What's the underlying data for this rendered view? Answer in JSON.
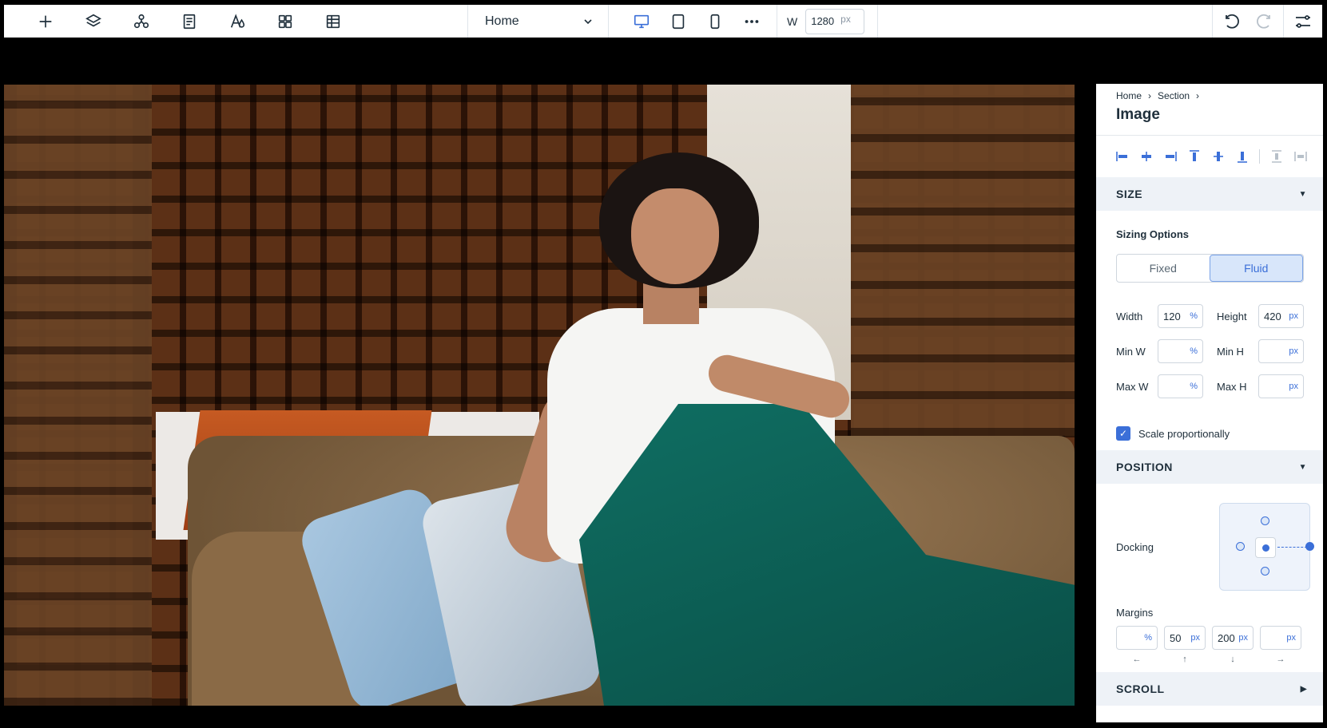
{
  "toolbar": {
    "page_select": "Home",
    "width_label": "W",
    "width_value": "1280",
    "width_unit": "px"
  },
  "panel": {
    "breadcrumb": [
      "Home",
      "Section"
    ],
    "title": "Image",
    "size_section": "SIZE",
    "sizing_options_label": "Sizing Options",
    "sizing_fixed": "Fixed",
    "sizing_fluid": "Fluid",
    "width_label": "Width",
    "width_value": "120",
    "width_unit": "%",
    "height_label": "Height",
    "height_value": "420",
    "height_unit": "px",
    "minw_label": "Min W",
    "minw_unit": "%",
    "minh_label": "Min H",
    "minh_unit": "px",
    "maxw_label": "Max W",
    "maxw_unit": "%",
    "maxh_label": "Max H",
    "maxh_unit": "px",
    "scale_label": "Scale proportionally",
    "position_section": "POSITION",
    "docking_label": "Docking",
    "margins_label": "Margins",
    "margin_left_unit": "%",
    "margin_top_value": "50",
    "margin_top_unit": "px",
    "margin_bottom_value": "200",
    "margin_bottom_unit": "px",
    "margin_right_unit": "px",
    "scroll_section": "SCROLL"
  },
  "colors": {
    "accent": "#3b6fd8",
    "section_bg": "#eef2f7"
  }
}
